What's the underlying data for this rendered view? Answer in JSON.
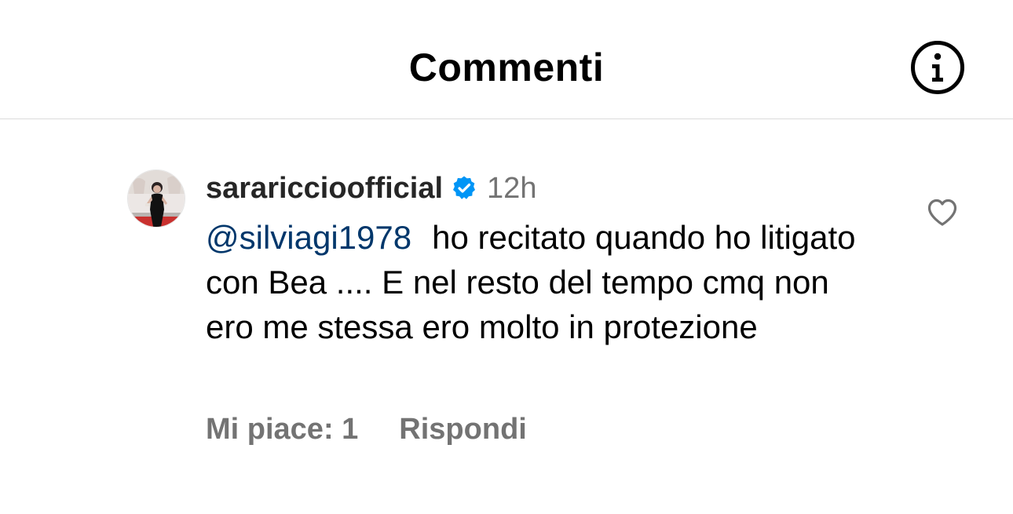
{
  "header": {
    "title": "Commenti",
    "info_icon": "info-icon"
  },
  "comment": {
    "username": "sarariccioofficial",
    "verified": true,
    "time": "12h",
    "mention": "@silviagi1978",
    "text": "ho recitato quando ho litigato con Bea .... E nel resto del tempo cmq non ero me stessa ero molto in protezione",
    "likes_label": "Mi piace: 1",
    "reply_label": "Rispondi",
    "like_icon": "heart-outline-icon"
  },
  "colors": {
    "mention": "#00376b",
    "secondary_text": "#737373",
    "verified": "#0095f6",
    "divider": "#dbdbdb"
  }
}
